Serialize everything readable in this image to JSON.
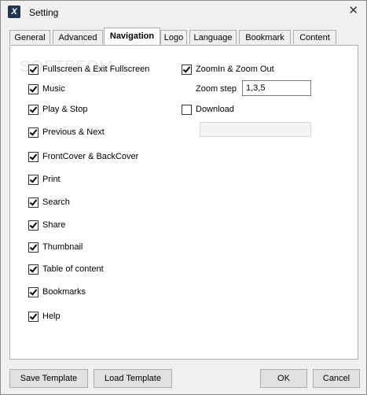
{
  "window": {
    "title": "Setting",
    "app_icon_letter": "X"
  },
  "tabs": [
    {
      "label": "General"
    },
    {
      "label": "Advanced"
    },
    {
      "label": "Navigation"
    },
    {
      "label": "Logo"
    },
    {
      "label": "Language"
    },
    {
      "label": "Bookmark"
    },
    {
      "label": "Content"
    }
  ],
  "active_tab": "Navigation",
  "options_left": [
    {
      "label": "Fullscreen & Exit Fullscreen",
      "checked": true
    },
    {
      "label": "Music",
      "checked": true
    },
    {
      "label": "Play & Stop",
      "checked": true
    },
    {
      "label": "Previous & Next",
      "checked": true
    },
    {
      "label": "FrontCover & BackCover",
      "checked": true
    },
    {
      "label": "Print",
      "checked": true
    },
    {
      "label": "Search",
      "checked": true
    },
    {
      "label": "Share",
      "checked": true
    },
    {
      "label": "Thumbnail",
      "checked": true
    },
    {
      "label": "Table of content",
      "checked": true
    },
    {
      "label": "Bookmarks",
      "checked": true
    },
    {
      "label": "Help",
      "checked": true
    }
  ],
  "zoom": {
    "label": "ZoomIn & Zoom Out",
    "checked": true,
    "step_label": "Zoom step",
    "step_value": "1,3,5"
  },
  "download": {
    "label": "Download",
    "checked": false,
    "path_value": ""
  },
  "watermark": "SOFTPEDIA",
  "buttons": {
    "save_template": "Save  Template",
    "load_template": "Load  Template",
    "ok": "OK",
    "cancel": "Cancel"
  }
}
